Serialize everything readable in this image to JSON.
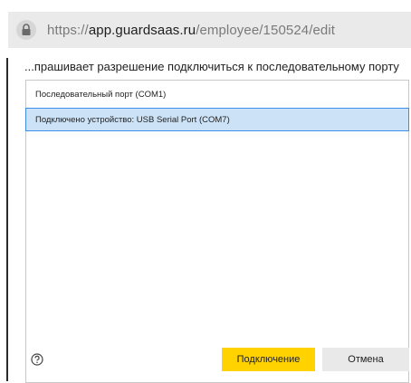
{
  "address_bar": {
    "url_scheme": "https://",
    "url_host": "app.guardsaas.ru",
    "url_path": "/employee/150524/edit",
    "icon": "lock-icon"
  },
  "dialog": {
    "prompt": "...прашивает разрешение подключиться к последовательному порту",
    "ports": [
      {
        "label": "Последовательный порт (COM1)",
        "selected": false
      },
      {
        "label": "Подключено устройство: USB Serial Port (COM7)",
        "selected": true
      }
    ],
    "help_icon": "question-circle-icon",
    "connect_label": "Подключение",
    "cancel_label": "Отмена"
  },
  "colors": {
    "accent": "#ffd200",
    "selection_bg": "#cce2f7",
    "selection_border": "#3d8ee8",
    "urlbar_bg": "#eaeaea"
  }
}
